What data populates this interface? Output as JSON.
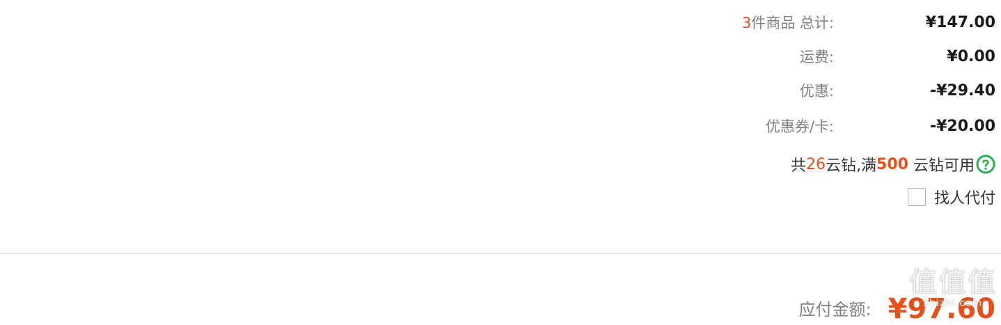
{
  "summary": {
    "items": {
      "count": "3",
      "label": "件商品 总计:",
      "value": "¥147.00"
    },
    "shipping": {
      "label": "运费:",
      "value": "¥0.00"
    },
    "discount": {
      "label": "优惠:",
      "value": "-¥29.40"
    },
    "coupon": {
      "label": "优惠券/卡:",
      "value": "-¥20.00"
    }
  },
  "coins": {
    "prefix": "共 ",
    "count": "26",
    "middle": "云钻,满",
    "threshold": "500",
    "suffix": "云钻可用",
    "help_icon": "question-circle-icon",
    "help_color": "#2bb24c"
  },
  "paid_by_other": {
    "label": "找人代付",
    "checked": false
  },
  "total": {
    "label": "应付金额:",
    "value": "¥97.60"
  },
  "watermark": {
    "text": "值值值",
    "subtext": "zhizhi.com"
  },
  "colors": {
    "accent": "#e5511d",
    "muted": "#808080",
    "text": "#333333"
  }
}
